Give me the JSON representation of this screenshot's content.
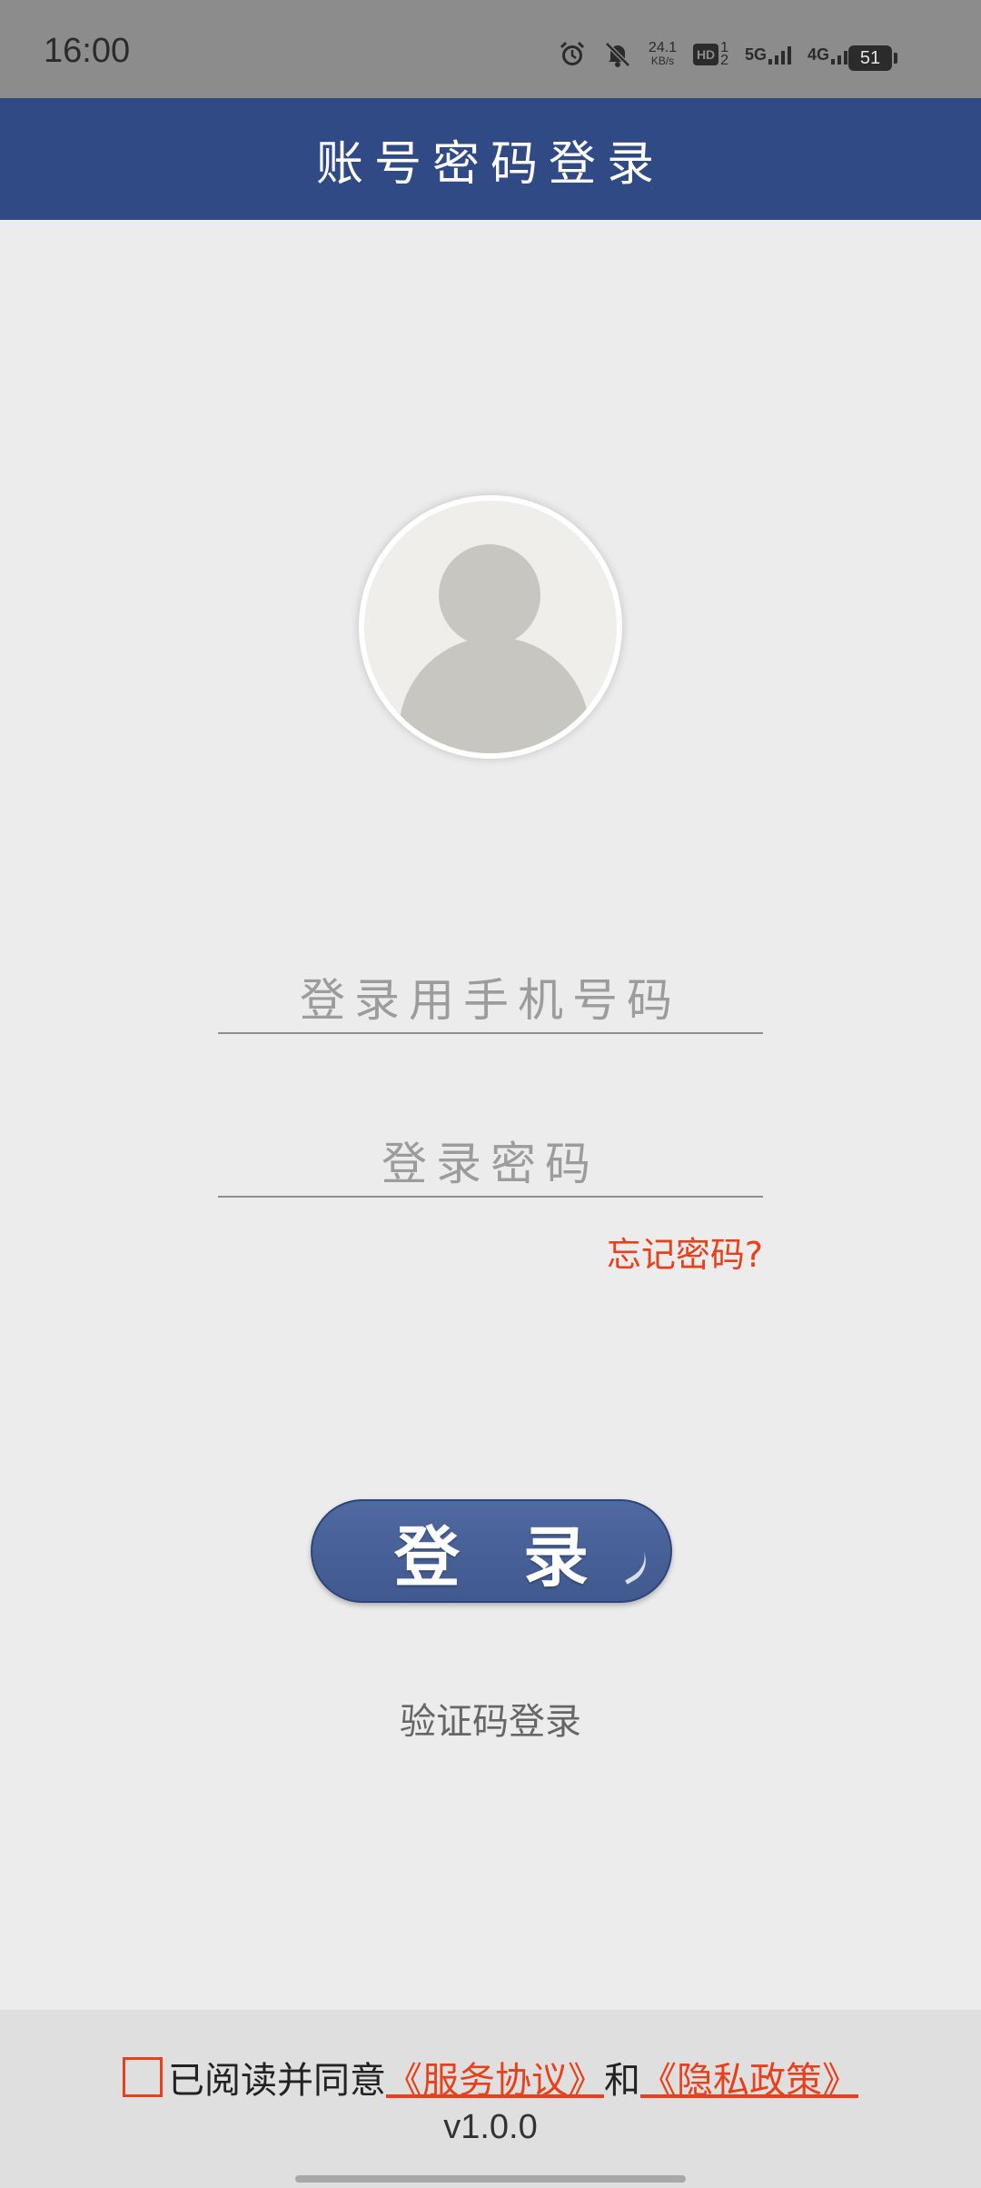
{
  "status_bar": {
    "time": "16:00",
    "icons": [
      "alarm-icon",
      "mute-icon",
      "network-speed",
      "hd-icon",
      "signal-5g-icon",
      "signal-4g-icon",
      "battery-icon"
    ],
    "net_speed_value": "24.1",
    "net_speed_unit": "KB/s",
    "hd_label": "HD",
    "sim_labels": [
      "1",
      "2"
    ],
    "net_5g": "5G",
    "net_4g": "4G",
    "battery": "51"
  },
  "header": {
    "title": "账号密码登录",
    "background_color": "#2f4a84"
  },
  "form": {
    "phone_placeholder": "登录用手机号码",
    "phone_value": "",
    "password_placeholder": "登录密码",
    "password_value": "",
    "forgot_password": "忘记密码?",
    "login_button": "登录",
    "sms_login": "验证码登录"
  },
  "footer": {
    "agreement_prefix": "已阅读并同意",
    "service_agreement": "《服务协议》",
    "and": "和",
    "privacy_policy": "《隐私政策》",
    "version": "v1.0.0",
    "checkbox_checked": false
  },
  "colors": {
    "accent": "#e8401a",
    "header": "#2f4a84",
    "button": "#4a639a"
  }
}
